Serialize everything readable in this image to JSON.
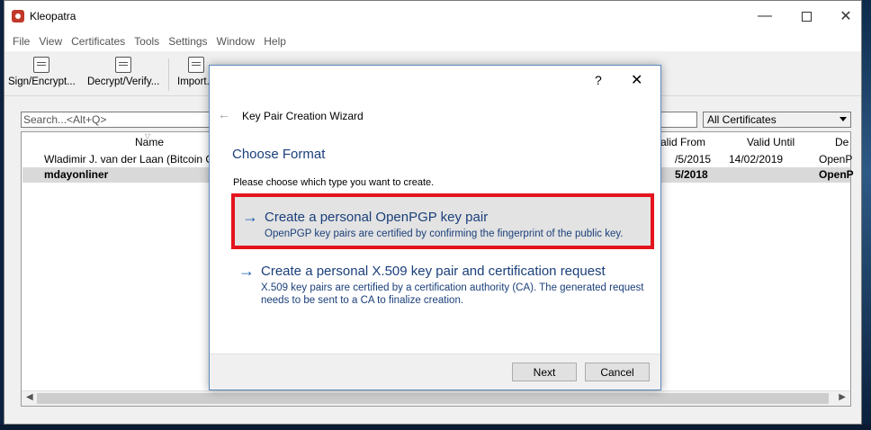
{
  "window": {
    "title": "Kleopatra",
    "minimize": "—",
    "close": "✕"
  },
  "menu": [
    "File",
    "View",
    "Certificates",
    "Tools",
    "Settings",
    "Window",
    "Help"
  ],
  "toolbar": {
    "sign": "Sign/Encrypt...",
    "decrypt": "Decrypt/Verify...",
    "import": "Import..."
  },
  "search": {
    "placeholder": "Search...<Alt+Q>"
  },
  "filter": {
    "selected": "All Certificates"
  },
  "table": {
    "headers": {
      "name": "Name",
      "valid_from": "alid From",
      "valid_until": "Valid Until",
      "details": "De"
    },
    "rows": [
      {
        "name": "Wladimir J. van der Laan (Bitcoin Co",
        "valid_from": "/5/2015",
        "valid_until": "14/02/2019",
        "details": "OpenP"
      },
      {
        "name": "mdayonliner",
        "valid_from": "5/2018",
        "valid_until": "",
        "details": "OpenP"
      }
    ]
  },
  "dialog": {
    "help": "?",
    "close": "✕",
    "back": "←",
    "title": "Key Pair Creation Wizard",
    "heading": "Choose Format",
    "instruction": "Please choose which type you want to create.",
    "options": [
      {
        "arrow": "→",
        "title": "Create a personal OpenPGP key pair",
        "description": "OpenPGP key pairs are certified by confirming the fingerprint of the public key."
      },
      {
        "arrow": "→",
        "title": "Create a personal X.509 key pair and certification request",
        "description": "X.509 key pairs are certified by a certification authority (CA). The generated request needs to be sent to a CA to finalize creation."
      }
    ],
    "next_label": "Next",
    "cancel_label": "Cancel"
  },
  "colors": {
    "highlight_border": "#e4141d",
    "heading_blue": "#1a3f7a",
    "arrow_blue": "#1e5fb0"
  },
  "icons": [
    "app-icon",
    "sign-encrypt-icon",
    "decrypt-verify-icon",
    "import-icon",
    "back-arrow-icon",
    "dropdown-arrow-icon"
  ]
}
